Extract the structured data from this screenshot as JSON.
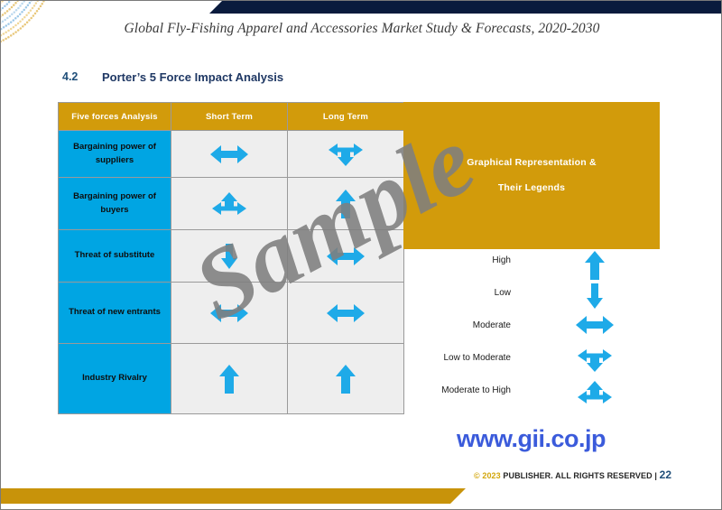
{
  "header": {
    "doc_title": "Global Fly-Fishing Apparel and Accessories Market Study & Forecasts, 2020-2030"
  },
  "section": {
    "number": "4.2",
    "title": "Porter’s 5 Force Impact Analysis"
  },
  "table": {
    "columns": [
      "Five forces Analysis",
      "Short Term",
      "Long Term"
    ],
    "rows": [
      {
        "label": "Bargaining power of suppliers",
        "short_term": "moderate-arrow",
        "long_term": "low-to-moderate-arrow"
      },
      {
        "label": "Bargaining power of buyers",
        "short_term": "moderate-to-high-arrow",
        "long_term": "high-arrow"
      },
      {
        "label": "Threat of substitute",
        "short_term": "low-arrow",
        "long_term": "moderate-arrow"
      },
      {
        "label": "Threat of new entrants",
        "short_term": "moderate-arrow",
        "long_term": "moderate-arrow"
      },
      {
        "label": "Industry Rivalry",
        "short_term": "high-arrow",
        "long_term": "high-arrow"
      }
    ]
  },
  "legend_panel": {
    "line1": "Graphical Representation &",
    "line2": "Their Legends"
  },
  "legend": {
    "items": [
      {
        "label": "High",
        "symbol": "high-arrow"
      },
      {
        "label": "Low",
        "symbol": "low-arrow"
      },
      {
        "label": "Moderate",
        "symbol": "moderate-arrow"
      },
      {
        "label": "Low to Moderate",
        "symbol": "low-to-moderate-arrow"
      },
      {
        "label": "Moderate to High",
        "symbol": "moderate-to-high-arrow"
      }
    ]
  },
  "footer": {
    "url": "www.gii.co.jp",
    "copyright_mark": "©",
    "year": "2023",
    "rights": "PUBLISHER. ALL RIGHTS RESERVED",
    "separator": "|",
    "page_number": "22"
  },
  "watermark": {
    "text": "Sample"
  },
  "colors": {
    "gold": "#d29b0b",
    "cyan": "#00a5e3",
    "navy": "#0a1b3d",
    "arrow_blue": "#1eaae8",
    "url_blue": "#3b5bdb",
    "cell_gray": "#eeeeee"
  }
}
